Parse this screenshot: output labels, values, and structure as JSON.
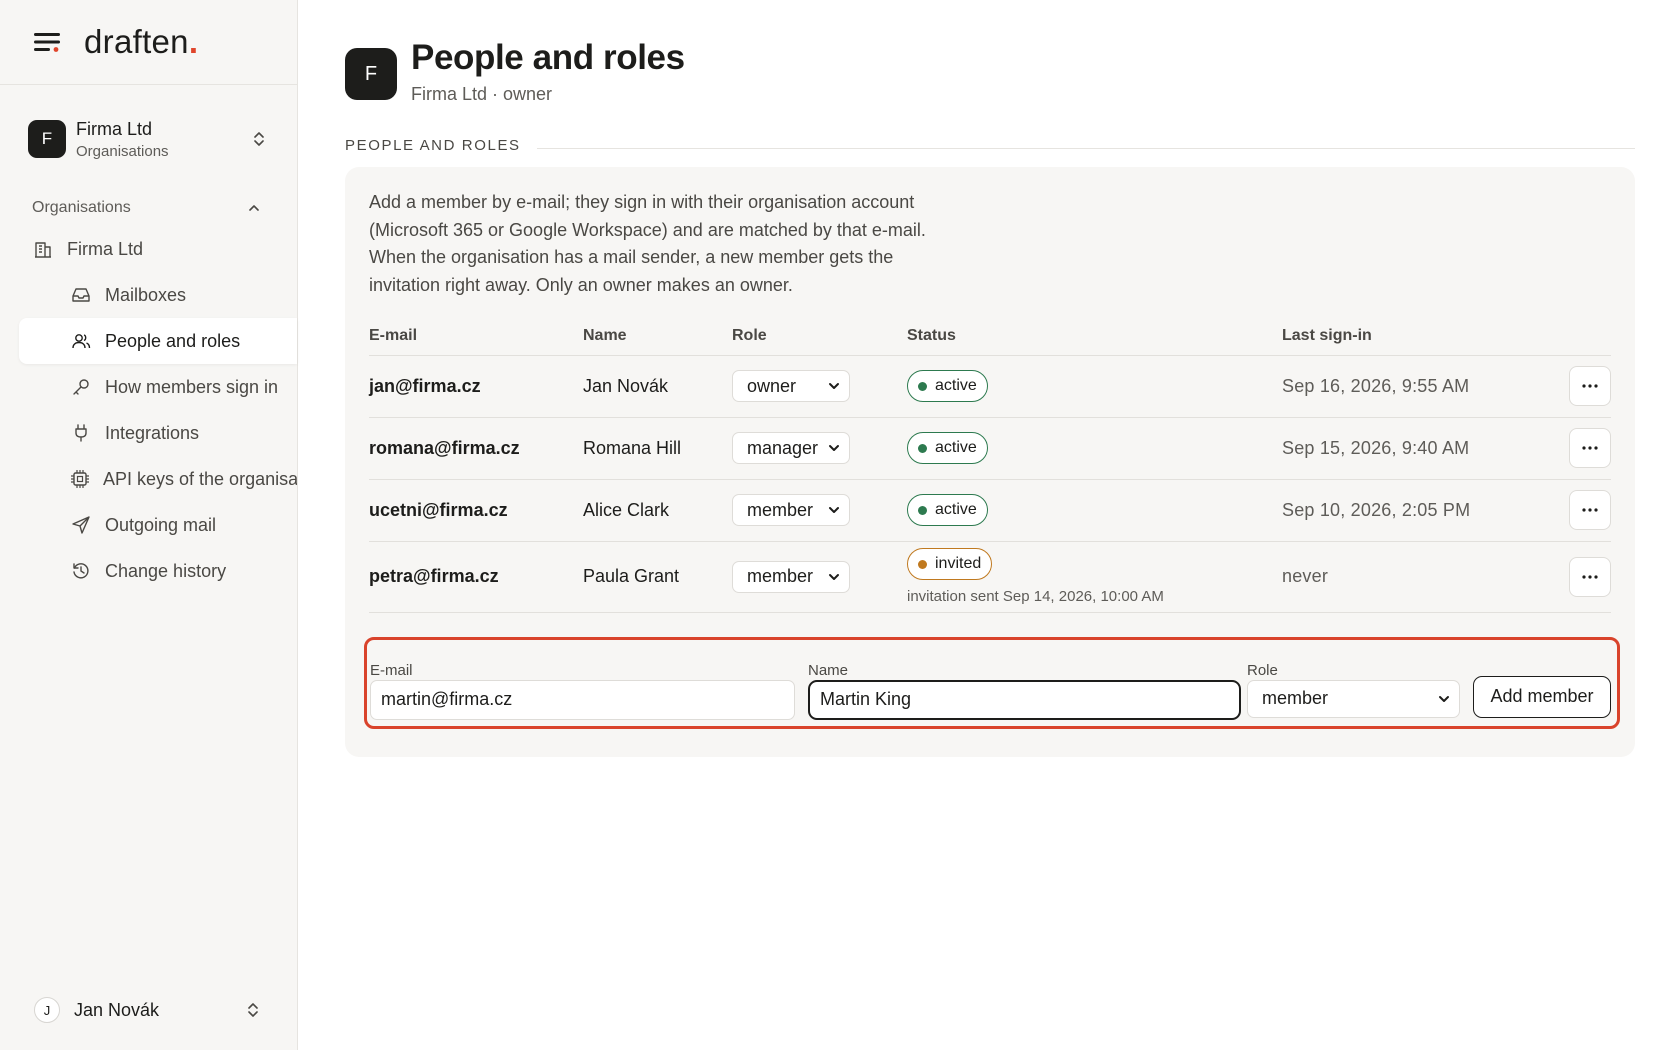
{
  "brand": {
    "logo": "draften",
    "logo_dot": "."
  },
  "org_switcher": {
    "initial": "F",
    "name": "Firma Ltd",
    "sub": "Organisations"
  },
  "sidebar": {
    "section_label": "Organisations",
    "org_item": "Firma Ltd",
    "items": [
      {
        "label": "Mailboxes",
        "icon": "inbox-icon"
      },
      {
        "label": "People and roles",
        "icon": "users-icon",
        "active": true
      },
      {
        "label": "How members sign in",
        "icon": "key-icon"
      },
      {
        "label": "Integrations",
        "icon": "plug-icon"
      },
      {
        "label": "API keys of the organisation",
        "icon": "chip-icon"
      },
      {
        "label": "Outgoing mail",
        "icon": "send-icon"
      },
      {
        "label": "Change history",
        "icon": "history-icon"
      }
    ]
  },
  "user": {
    "initial": "J",
    "name": "Jan Novák"
  },
  "page": {
    "avatar": "F",
    "title": "People and roles",
    "subtitle": "Firma Ltd · owner",
    "section_title": "PEOPLE AND ROLES",
    "intro": "Add a member by e-mail; they sign in with their organisation account (Microsoft 365 or Google Workspace) and are matched by that e-mail. When the organisation has a mail sender, a new member gets the invitation right away. Only an owner makes an owner."
  },
  "table": {
    "headers": {
      "email": "E-mail",
      "name": "Name",
      "role": "Role",
      "status": "Status",
      "last": "Last sign-in"
    },
    "rows": [
      {
        "email": "jan@firma.cz",
        "name": "Jan Novák",
        "role": "owner",
        "status": "active",
        "last": "Sep 16, 2026, 9:55 AM"
      },
      {
        "email": "romana@firma.cz",
        "name": "Romana Hill",
        "role": "manager",
        "status": "active",
        "last": "Sep 15, 2026, 9:40 AM"
      },
      {
        "email": "ucetni@firma.cz",
        "name": "Alice Clark",
        "role": "member",
        "status": "active",
        "last": "Sep 10, 2026, 2:05 PM"
      },
      {
        "email": "petra@firma.cz",
        "name": "Paula Grant",
        "role": "member",
        "status": "invited",
        "note": "invitation sent Sep 14, 2026, 10:00 AM",
        "last": "never"
      }
    ]
  },
  "add_form": {
    "email_label": "E-mail",
    "email_value": "martin@firma.cz",
    "name_label": "Name",
    "name_value": "Martin King",
    "role_label": "Role",
    "role_value": "member",
    "button": "Add member"
  },
  "colors": {
    "accent": "#e0452b",
    "highlight_border": "#d9432b",
    "active_green": "#2d7a4f",
    "invited_amber": "#c0791f",
    "sidebar_bg": "#f7f6f4"
  }
}
